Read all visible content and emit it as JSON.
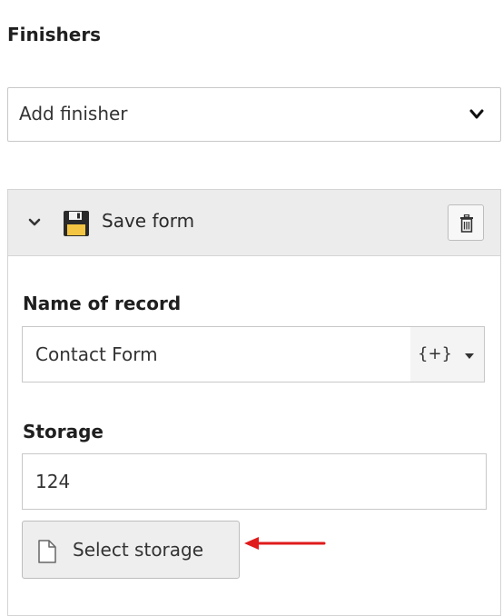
{
  "finishers": {
    "title": "Finishers",
    "add_select": {
      "selected": "Add finisher",
      "icon": "chevron-down-icon"
    }
  },
  "finisher_panel": {
    "title": "Save form",
    "collapse_icon": "chevron-down-icon",
    "type_icon": "floppy-disk-icon",
    "delete_icon": "trash-icon",
    "fields": {
      "name_of_record": {
        "label": "Name of record",
        "value": "Contact Form",
        "placeholder_button_label": "{+}"
      },
      "storage": {
        "label": "Storage",
        "value": "124",
        "select_button_label": "Select storage",
        "select_button_icon": "document-icon"
      }
    }
  },
  "annotation": {
    "arrow_color": "#e01b1b"
  }
}
